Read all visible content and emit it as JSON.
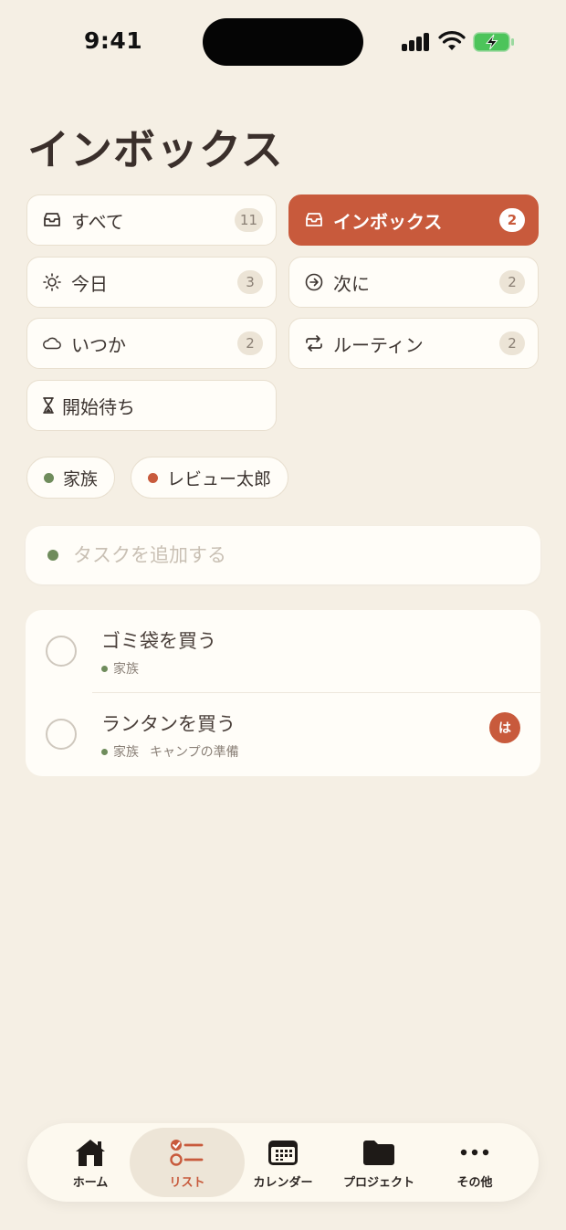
{
  "status": {
    "time": "9:41"
  },
  "page": {
    "title": "インボックス"
  },
  "filters": [
    {
      "label": "すべて",
      "count": "11",
      "icon": "tray-icon"
    },
    {
      "label": "インボックス",
      "count": "2",
      "icon": "inbox-icon",
      "active": true
    },
    {
      "label": "今日",
      "count": "3",
      "icon": "sun-icon"
    },
    {
      "label": "次に",
      "count": "2",
      "icon": "arrow-circle-icon"
    },
    {
      "label": "いつか",
      "count": "2",
      "icon": "cloud-icon"
    },
    {
      "label": "ルーティン",
      "count": "2",
      "icon": "repeat-icon"
    },
    {
      "label": "開始待ち",
      "icon": "hourglass-icon"
    }
  ],
  "tags": [
    {
      "label": "家族",
      "color": "#6f8c5c"
    },
    {
      "label": "レビュー太郎",
      "color": "#c85a3c"
    }
  ],
  "add_task": {
    "placeholder": "タスクを追加する"
  },
  "tasks": [
    {
      "title": "ゴミ袋を買う",
      "tag": "家族",
      "project": ""
    },
    {
      "title": "ランタンを買う",
      "tag": "家族",
      "project": "キャンプの準備",
      "assignee": "は"
    }
  ],
  "tabbar": [
    {
      "label": "ホーム",
      "icon": "home-icon"
    },
    {
      "label": "リスト",
      "icon": "list-icon",
      "active": true
    },
    {
      "label": "カレンダー",
      "icon": "calendar-icon"
    },
    {
      "label": "プロジェクト",
      "icon": "folder-icon"
    },
    {
      "label": "その他",
      "icon": "more-icon"
    }
  ],
  "colors": {
    "accent": "#c85a3c",
    "family_green": "#6f8c5c",
    "background": "#f5efe4"
  }
}
